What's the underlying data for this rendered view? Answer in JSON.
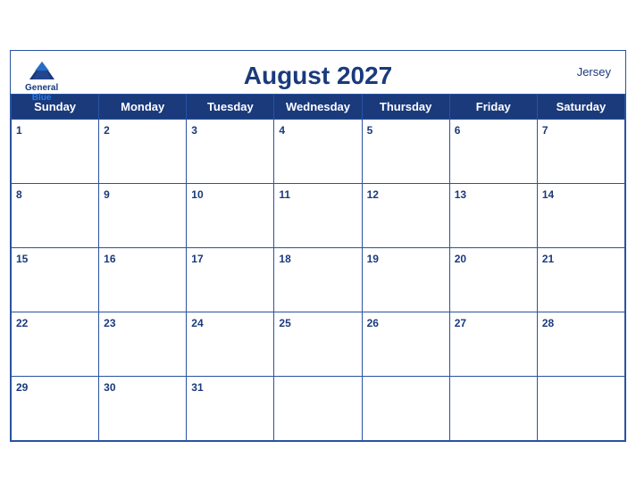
{
  "header": {
    "title": "August 2027",
    "location": "Jersey",
    "logo_general": "General",
    "logo_blue": "Blue"
  },
  "weekdays": [
    "Sunday",
    "Monday",
    "Tuesday",
    "Wednesday",
    "Thursday",
    "Friday",
    "Saturday"
  ],
  "weeks": [
    [
      1,
      2,
      3,
      4,
      5,
      6,
      7
    ],
    [
      8,
      9,
      10,
      11,
      12,
      13,
      14
    ],
    [
      15,
      16,
      17,
      18,
      19,
      20,
      21
    ],
    [
      22,
      23,
      24,
      25,
      26,
      27,
      28
    ],
    [
      29,
      30,
      31,
      null,
      null,
      null,
      null
    ]
  ],
  "colors": {
    "header_bg": "#1a3a7c",
    "border": "#2a52a0",
    "text_dark": "#1a3a7c",
    "text_white": "#ffffff"
  }
}
